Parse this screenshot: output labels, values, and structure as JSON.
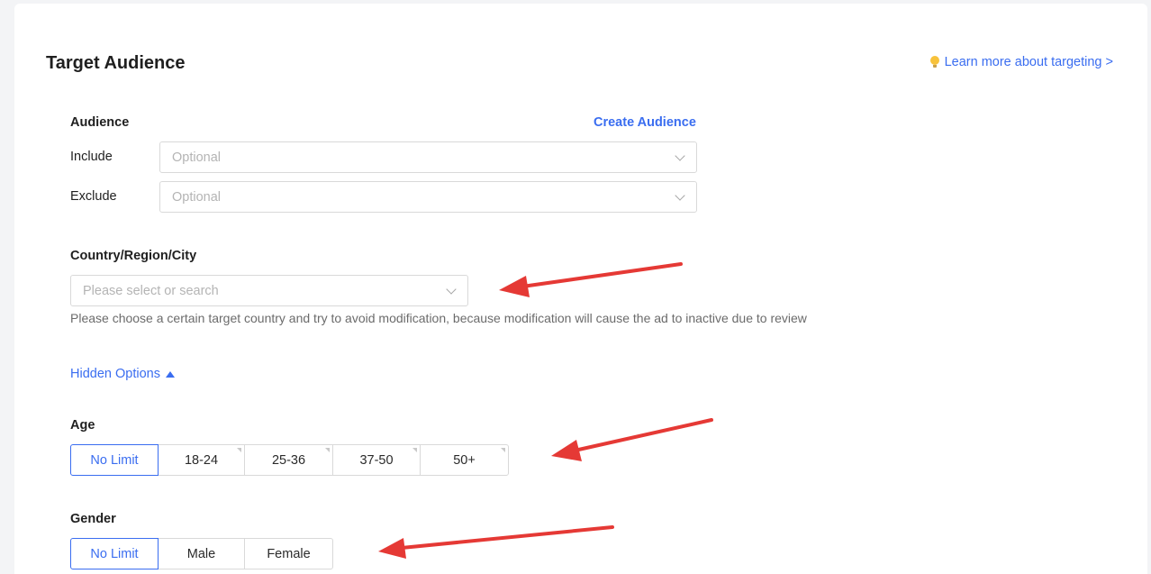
{
  "header": {
    "title": "Target Audience",
    "learn_more": "Learn more about targeting >"
  },
  "audience": {
    "label": "Audience",
    "create_link": "Create Audience",
    "include_label": "Include",
    "include_placeholder": "Optional",
    "exclude_label": "Exclude",
    "exclude_placeholder": "Optional"
  },
  "location": {
    "label": "Country/Region/City",
    "placeholder": "Please select or search",
    "hint": "Please choose a certain target country and try to avoid modification, because modification will cause the ad to inactive due to review"
  },
  "hidden_options": {
    "label": "Hidden Options"
  },
  "age": {
    "label": "Age",
    "options": [
      "No Limit",
      "18-24",
      "25-36",
      "37-50",
      "50+"
    ],
    "selected": "No Limit"
  },
  "gender": {
    "label": "Gender",
    "options": [
      "No Limit",
      "Male",
      "Female"
    ],
    "selected": "No Limit"
  },
  "colors": {
    "accent": "#3a6df0",
    "annotation_arrow": "#e53935"
  },
  "icons": {
    "learn_more": "lightbulb-icon",
    "dropdown": "chevron-down-icon",
    "hidden_options_toggle": "triangle-up-icon"
  }
}
